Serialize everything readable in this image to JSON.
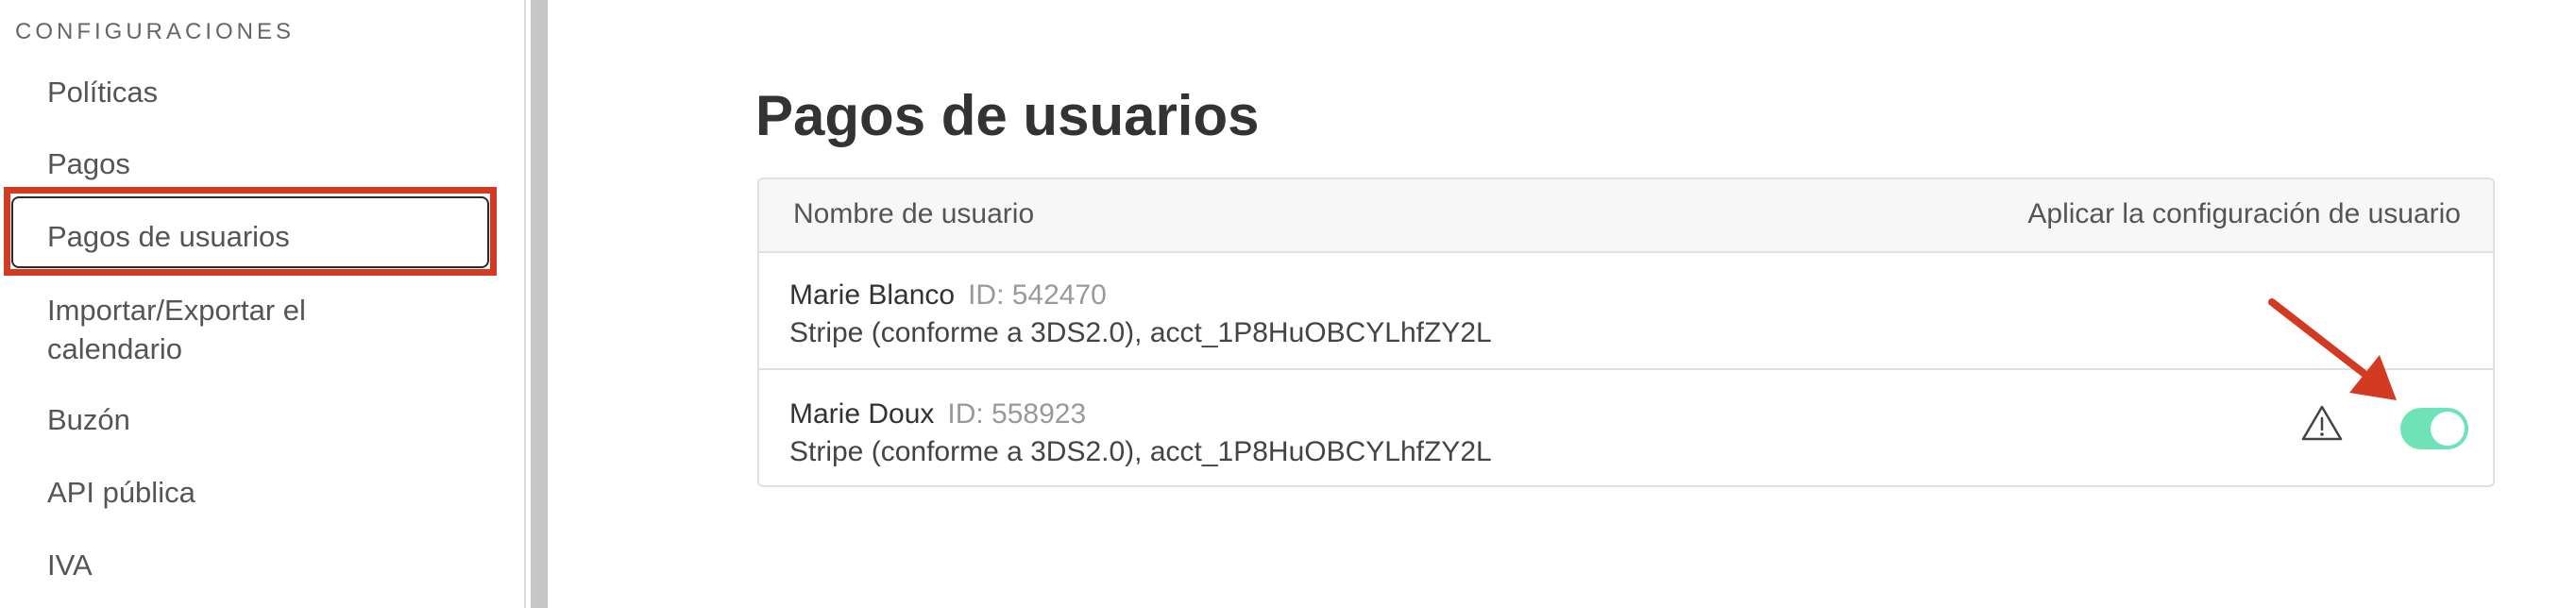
{
  "sidebar": {
    "heading": "CONFIGURACIONES",
    "items": [
      {
        "label": "Políticas"
      },
      {
        "label": "Pagos"
      },
      {
        "label": "Pagos de usuarios"
      },
      {
        "label": "Importar/Exportar el calendario"
      },
      {
        "label": "Buzón"
      },
      {
        "label": "API pública"
      },
      {
        "label": "IVA"
      }
    ],
    "active_index": 2
  },
  "main": {
    "title": "Pagos de usuarios",
    "table": {
      "columns": [
        "Nombre de usuario",
        "Aplicar la configuración de usuario"
      ],
      "rows": [
        {
          "name": "Marie Blanco",
          "id": "ID: 542470",
          "account": "Stripe (conforme a 3DS2.0), acct_1P8HuOBCYLhfZY2L",
          "toggle_on": false
        },
        {
          "name": "Marie Doux",
          "id": "ID: 558923",
          "account": "Stripe (conforme a 3DS2.0), acct_1P8HuOBCYLhfZY2L",
          "toggle_on": true,
          "warning_icon": "warning-triangle-icon"
        }
      ]
    }
  },
  "colors": {
    "highlight": "#d33a22",
    "toggle_on": "#6ee3b8",
    "arrow": "#d33a22"
  }
}
